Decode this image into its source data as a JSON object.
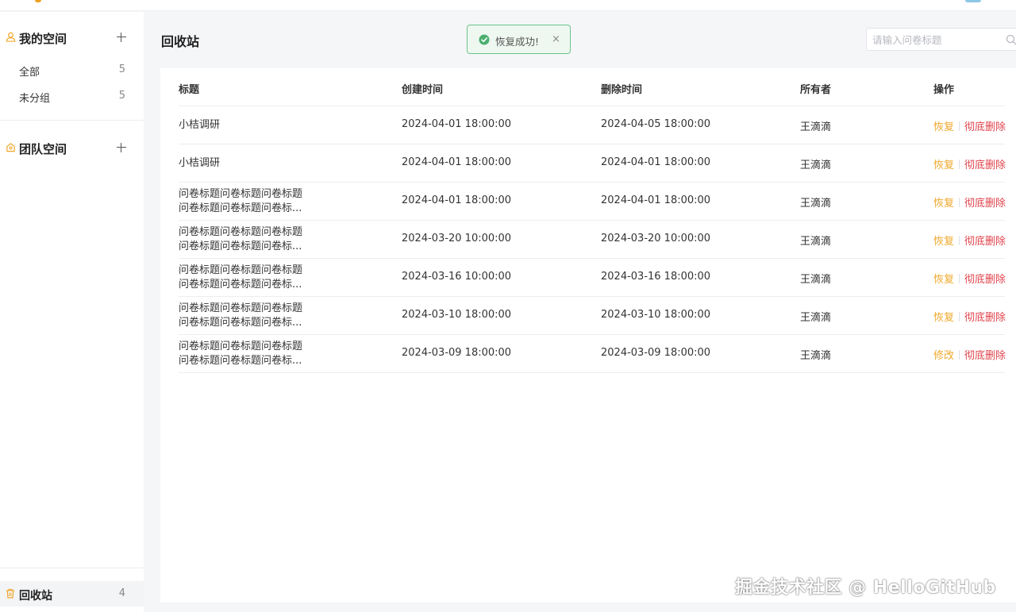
{
  "sidebar": {
    "my_space": {
      "title": "我的空间",
      "icon": "user-icon"
    },
    "items": [
      {
        "label": "全部",
        "count": "5"
      },
      {
        "label": "未分组",
        "count": "5"
      }
    ],
    "team_space": {
      "title": "团队空间",
      "icon": "team-icon"
    },
    "trash": {
      "label": "回收站",
      "count": "4",
      "icon": "trash-icon"
    }
  },
  "main": {
    "title": "回收站",
    "toast": {
      "message": "恢复成功!",
      "close": "×"
    },
    "search": {
      "placeholder": "请输入问卷标题",
      "value": ""
    },
    "table": {
      "headers": [
        "标题",
        "创建时间",
        "删除时间",
        "所有者",
        "操作"
      ],
      "rows": [
        {
          "title": [
            "小桔调研"
          ],
          "created": "2024-04-01 18:00:00",
          "deleted": "2024-04-05 18:00:00",
          "owner": "王滴滴",
          "action1": "恢复",
          "action2": "彻底删除"
        },
        {
          "title": [
            "小桔调研"
          ],
          "created": "2024-04-01 18:00:00",
          "deleted": "2024-04-01 18:00:00",
          "owner": "王滴滴",
          "action1": "恢复",
          "action2": "彻底删除"
        },
        {
          "title": [
            "问卷标题问卷标题问卷标题",
            "问卷标题问卷标题问卷标..."
          ],
          "created": "2024-04-01 18:00:00",
          "deleted": "2024-04-01 18:00:00",
          "owner": "王滴滴",
          "action1": "恢复",
          "action2": "彻底删除"
        },
        {
          "title": [
            "问卷标题问卷标题问卷标题",
            "问卷标题问卷标题问卷标..."
          ],
          "created": "2024-03-20 10:00:00",
          "deleted": "2024-03-20 10:00:00",
          "owner": "王滴滴",
          "action1": "恢复",
          "action2": "彻底删除"
        },
        {
          "title": [
            "问卷标题问卷标题问卷标题",
            "问卷标题问卷标题问卷标..."
          ],
          "created": "2024-03-16 10:00:00",
          "deleted": "2024-03-16 18:00:00",
          "owner": "王滴滴",
          "action1": "恢复",
          "action2": "彻底删除"
        },
        {
          "title": [
            "问卷标题问卷标题问卷标题",
            "问卷标题问卷标题问卷标..."
          ],
          "created": "2024-03-10 18:00:00",
          "deleted": "2024-03-10 18:00:00",
          "owner": "王滴滴",
          "action1": "恢复",
          "action2": "彻底删除"
        },
        {
          "title": [
            "问卷标题问卷标题问卷标题",
            "问卷标题问卷标题问卷标..."
          ],
          "created": "2024-03-09 18:00:00",
          "deleted": "2024-03-09 18:00:00",
          "owner": "王滴滴",
          "action1": "修改",
          "action2": "彻底删除"
        }
      ]
    }
  },
  "watermark": "掘金技术社区 @ HelloGitHub",
  "colors": {
    "accent": "#f0a82c",
    "danger": "#e0434b",
    "success": "#4caf6e"
  }
}
